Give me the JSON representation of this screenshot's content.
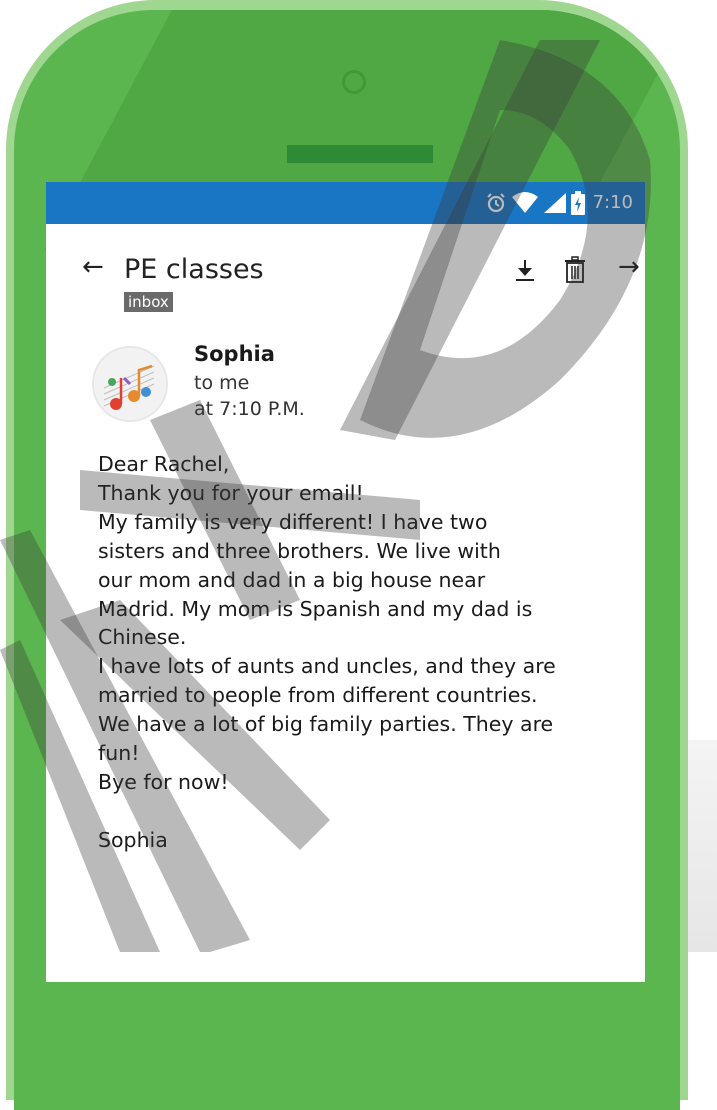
{
  "status_bar": {
    "time": "7:10",
    "icons": [
      "alarm-icon",
      "wifi-icon",
      "signal-icon",
      "battery-icon"
    ]
  },
  "email": {
    "subject": "PE classes",
    "label": "inbox",
    "actions": [
      "download-icon",
      "trash-icon"
    ],
    "nav": {
      "back": "←",
      "forward": "→"
    },
    "sender": {
      "name": "Sophia",
      "recipient": "to me",
      "time": "at 7:10 P.M."
    },
    "body_lines": [
      "Dear Rachel,",
      "Thank you for your email!",
      "My family is very different! I have two",
      "sisters and three brothers. We live with",
      "our mom and dad in a big house near",
      "Madrid. My mom is Spanish and my dad is",
      "Chinese.",
      "I have lots of aunts and uncles, and they are",
      "married to people from different countries.",
      "We have a lot of big family parties. They are",
      "fun!",
      "Bye for now!",
      "",
      "Sophia"
    ]
  },
  "colors": {
    "phone_green": "#5cb64f",
    "phone_rim": "#9fd690",
    "status_blue": "#1976c4",
    "watermark": "#3a3a3a"
  }
}
